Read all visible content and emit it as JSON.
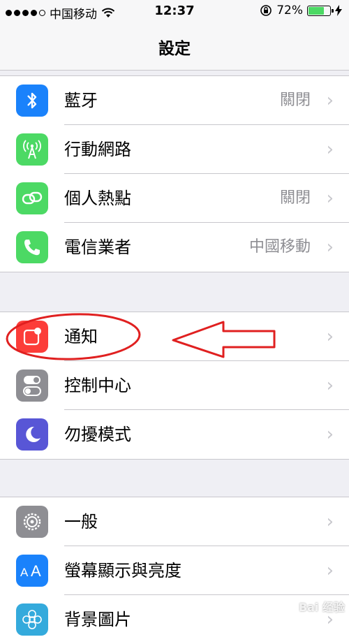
{
  "status_bar": {
    "carrier": "中国移动",
    "time": "12:37",
    "battery": "72%",
    "battery_level": 0.72
  },
  "nav": {
    "title": "設定"
  },
  "groups": [
    {
      "items": [
        {
          "label": "藍牙",
          "value": "關閉",
          "icon": "bluetooth-icon",
          "color": "#1a82fb"
        },
        {
          "label": "行動網路",
          "value": "",
          "icon": "cellular-antenna-icon",
          "color": "#4cd964"
        },
        {
          "label": "個人熱點",
          "value": "關閉",
          "icon": "hotspot-chain-icon",
          "color": "#4cd964"
        },
        {
          "label": "電信業者",
          "value": "中國移動",
          "icon": "phone-icon",
          "color": "#4cd964"
        }
      ]
    },
    {
      "items": [
        {
          "label": "通知",
          "value": "",
          "icon": "notifications-icon",
          "color": "#fc3d39"
        },
        {
          "label": "控制中心",
          "value": "",
          "icon": "control-center-toggles-icon",
          "color": "#8e8e93"
        },
        {
          "label": "勿擾模式",
          "value": "",
          "icon": "moon-icon",
          "color": "#5856d6"
        }
      ]
    },
    {
      "items": [
        {
          "label": "一般",
          "value": "",
          "icon": "gear-icon",
          "color": "#8e8e93"
        },
        {
          "label": "螢幕顯示與亮度",
          "value": "",
          "icon": "text-size-aa-icon",
          "color": "#1a82fb"
        },
        {
          "label": "背景圖片",
          "value": "",
          "icon": "wallpaper-flower-icon",
          "color": "#34aadc"
        }
      ]
    }
  ],
  "chevron": "›",
  "annotation_color": "#e02020",
  "watermark": "Bai 经验"
}
